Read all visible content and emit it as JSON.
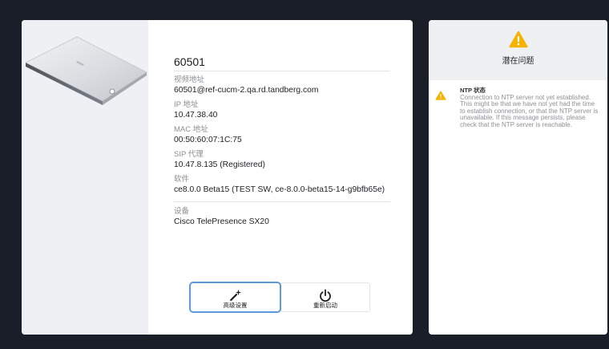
{
  "colors": {
    "background": "#1a1e28",
    "card": "#ffffff",
    "image_pane": "#eef0f3",
    "issues_header": "#eef0f2",
    "warning": "#f5b300",
    "focus_border": "#5b9bd9",
    "label_text": "#8b8e94",
    "value_text": "#1f2024"
  },
  "device": {
    "number": "60501",
    "fields": [
      {
        "label": "视频地址",
        "value": "60501@ref-cucm-2.qa.rd.tandberg.com"
      },
      {
        "label": "IP 地址",
        "value": "10.47.38.40"
      },
      {
        "label": "MAC 地址",
        "value": "00:50:60:07:1C:75"
      },
      {
        "label": "SIP 代理",
        "value": "10.47.8.135 (Registered)"
      },
      {
        "label": "软件",
        "value": "ce8.0.0 Beta15 (TEST SW, ce-8.0.0-beta15-14-g9bfb65e)"
      },
      {
        "label": "设备",
        "value": "Cisco TelePresence SX20"
      }
    ]
  },
  "actions": [
    {
      "label": "高级设置",
      "icon": "wand-icon",
      "focused": true
    },
    {
      "label": "重新启动",
      "icon": "power-icon",
      "focused": false
    }
  ],
  "issues": {
    "icon": "warning-icon",
    "title": "潜在问题",
    "items": [
      {
        "icon": "warning-icon",
        "title": "NTP 状态",
        "message_lines": [
          "Connection to NTP server not yet established.",
          "This might be that we have not yet had the time",
          "to establish connection, or that the NTP server is",
          "unavailable. If this message persists, please",
          "check that the NTP server is reachable."
        ]
      }
    ]
  }
}
